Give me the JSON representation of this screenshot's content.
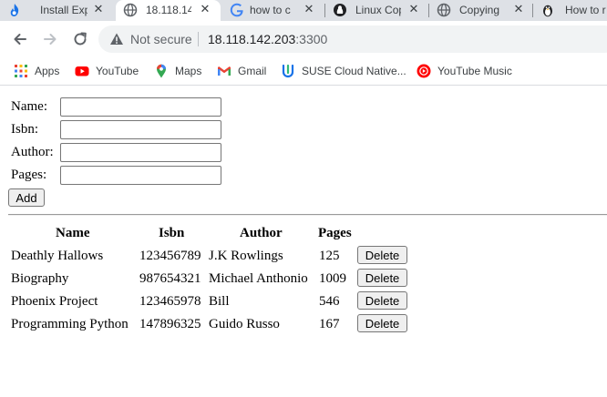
{
  "browser": {
    "tabs": [
      {
        "title": "Install Exp",
        "icon": "blue-flame-icon"
      },
      {
        "title": "18.118.14",
        "icon": "globe-icon",
        "active": true
      },
      {
        "title": "how to c",
        "icon": "google-icon"
      },
      {
        "title": "Linux Cop",
        "icon": "linux-icon"
      },
      {
        "title": "Copying",
        "icon": "globe-icon"
      },
      {
        "title": "How to r",
        "icon": "penguin-icon"
      }
    ],
    "address": {
      "security": "Not secure",
      "host": "18.118.142.203",
      "port": ":3300"
    },
    "bookmarks": [
      {
        "label": "Apps",
        "icon": "apps-grid-icon"
      },
      {
        "label": "YouTube",
        "icon": "youtube-icon"
      },
      {
        "label": "Maps",
        "icon": "maps-pin-icon"
      },
      {
        "label": "Gmail",
        "icon": "gmail-icon"
      },
      {
        "label": "SUSE Cloud Native...",
        "icon": "suse-icon"
      },
      {
        "label": "YouTube Music",
        "icon": "youtube-music-icon"
      }
    ]
  },
  "form": {
    "name_label": "Name:",
    "isbn_label": "Isbn:",
    "author_label": "Author:",
    "pages_label": "Pages:",
    "name_value": "",
    "isbn_value": "",
    "author_value": "",
    "pages_value": "",
    "add_label": "Add"
  },
  "table": {
    "headers": [
      "Name",
      "Isbn",
      "Author",
      "Pages"
    ],
    "rows": [
      {
        "name": "Deathly Hallows",
        "isbn": "123456789",
        "author": "J.K Rowlings",
        "pages": "125",
        "action": "Delete"
      },
      {
        "name": "Biography",
        "isbn": "987654321",
        "author": "Michael Anthonio",
        "pages": "1009",
        "action": "Delete"
      },
      {
        "name": "Phoenix Project",
        "isbn": "123465978",
        "author": "Bill",
        "pages": "546",
        "action": "Delete"
      },
      {
        "name": "Programming Python",
        "isbn": "147896325",
        "author": "Guido Russo",
        "pages": "167",
        "action": "Delete"
      }
    ]
  }
}
